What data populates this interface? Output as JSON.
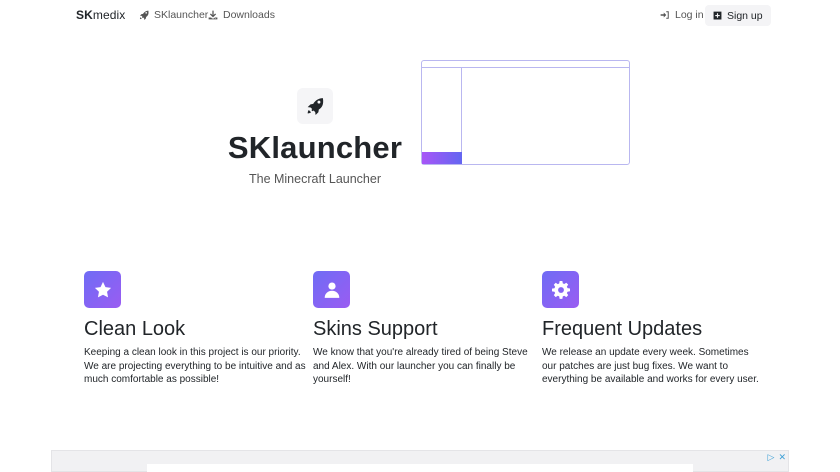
{
  "navbar": {
    "brand_bold": "SK",
    "brand_rest": "medix",
    "links": [
      {
        "label": "SKlauncher",
        "icon": "rocket-icon"
      },
      {
        "label": "Downloads",
        "icon": "download-icon"
      }
    ],
    "login_label": "Log in",
    "signup_label": "Sign up"
  },
  "hero": {
    "title": "SKlauncher",
    "subtitle": "The Minecraft Launcher",
    "logo_icon": "rocket-icon"
  },
  "features": [
    {
      "icon": "star-icon",
      "title": "Clean Look",
      "text": "Keeping a clean look in this project is our priority. We are projecting everything to be intuitive and as much comfortable as possible!"
    },
    {
      "icon": "user-icon",
      "title": "Skins Support",
      "text": "We know that you're already tired of being Steve and Alex. With our launcher you can finally be yourself!"
    },
    {
      "icon": "gear-icon",
      "title": "Frequent Updates",
      "text": "We release an update every week. Sometimes our patches are just bug fixes. We want to everything be available and works for every user."
    }
  ],
  "ad": {
    "choices_icon": "adchoices-icon",
    "close_label": "✕"
  },
  "colors": {
    "accent_start": "#6f6cf5",
    "accent_end": "#9a5cf2",
    "text": "#212529"
  }
}
